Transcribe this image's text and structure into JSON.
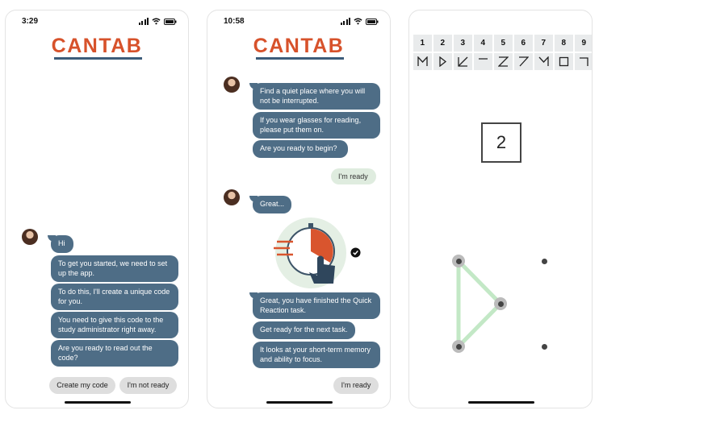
{
  "phone1": {
    "status_time": "3:29",
    "logo": "CANTAB",
    "greeting": "Hi",
    "bubbles": [
      "To get you started, we need to set up the app.",
      "To do this, I'll create a unique code for you.",
      "You need to give this code to the study administrator right away.",
      "Are you ready to read out the code?"
    ],
    "buttons": [
      "Create my code",
      "I'm not ready"
    ]
  },
  "phone2": {
    "status_time": "10:58",
    "logo": "CANTAB",
    "bubbles_a": [
      "Find a quiet place where you will not be interrupted.",
      "If you wear glasses for reading, please put them on.",
      "Are you ready to begin?"
    ],
    "reply": "I'm ready",
    "great": "Great...",
    "bubbles_b": [
      "Great, you have finished the Quick Reaction task.",
      "Get ready for the next task.",
      "It looks at your short-term memory and ability to focus."
    ],
    "button": "I'm ready",
    "illustration_icon": "stopwatch-tap-icon",
    "check_icon": "check-circle-icon"
  },
  "phone3": {
    "grid_numbers": [
      "1",
      "2",
      "3",
      "4",
      "5",
      "6",
      "7",
      "8",
      "9"
    ],
    "current_number": "2",
    "pattern_color": "#bfe7c2"
  },
  "colors": {
    "brand_orange": "#d7522b",
    "brand_navy": "#3c5c7a",
    "bubble": "#4e6d86",
    "reply_bubble": "#dfecdf"
  }
}
